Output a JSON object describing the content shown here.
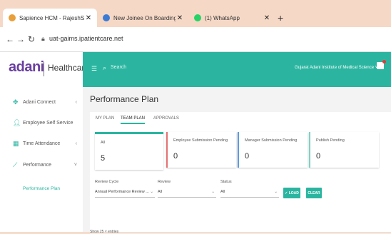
{
  "browser": {
    "tabs": [
      {
        "title": "Sapience HCM - RajeshSharma",
        "fav_color": "#e9a03a"
      },
      {
        "title": "New Joinee On Boarding / Off b",
        "fav_color": "#3b7bd6"
      },
      {
        "title": "(1) WhatsApp",
        "fav_color": "#25d366"
      }
    ],
    "url": "uat-gaims.ipatientcare.net"
  },
  "header": {
    "brand": "adani",
    "product": "Healthcare",
    "search_placeholder": "Search",
    "org": "Gujarat Adani Institute of Medical Science ˅"
  },
  "sidebar": {
    "items": [
      {
        "label": "Adani Connect",
        "icon": "puzzle-icon",
        "chevron": "‹"
      },
      {
        "label": "Employee Self Service",
        "icon": "person-icon",
        "chevron": ""
      },
      {
        "label": "Time Attendance",
        "icon": "calendar-icon",
        "chevron": "‹"
      },
      {
        "label": "Performance",
        "icon": "chart-icon",
        "chevron": "˅"
      }
    ],
    "subitem": "Performance Plan"
  },
  "main": {
    "title": "Performance Plan",
    "tabs": [
      "MY PLAN",
      "TEAM PLAN",
      "APPROVALS"
    ],
    "active_tab": "TEAM PLAN",
    "stats": [
      {
        "label": "All",
        "value": "5",
        "accent": "#2bb5a0"
      },
      {
        "label": "Employee Submission Pending",
        "value": "0",
        "accent": "#e57373"
      },
      {
        "label": "Manager Submission Pending",
        "value": "0",
        "accent": "#5c9be0"
      },
      {
        "label": "Publish Pending",
        "value": "0",
        "accent": "#7fd1c4"
      }
    ],
    "filters": [
      {
        "label": "Review Cycle",
        "value": "Annual Performance Review ..."
      },
      {
        "label": "Review",
        "value": "All"
      },
      {
        "label": "Status",
        "value": "All"
      }
    ],
    "load_button": "✓ LOAD",
    "clear_button": "CLEAR",
    "entries_text": "Show 25  ˅ entries"
  }
}
